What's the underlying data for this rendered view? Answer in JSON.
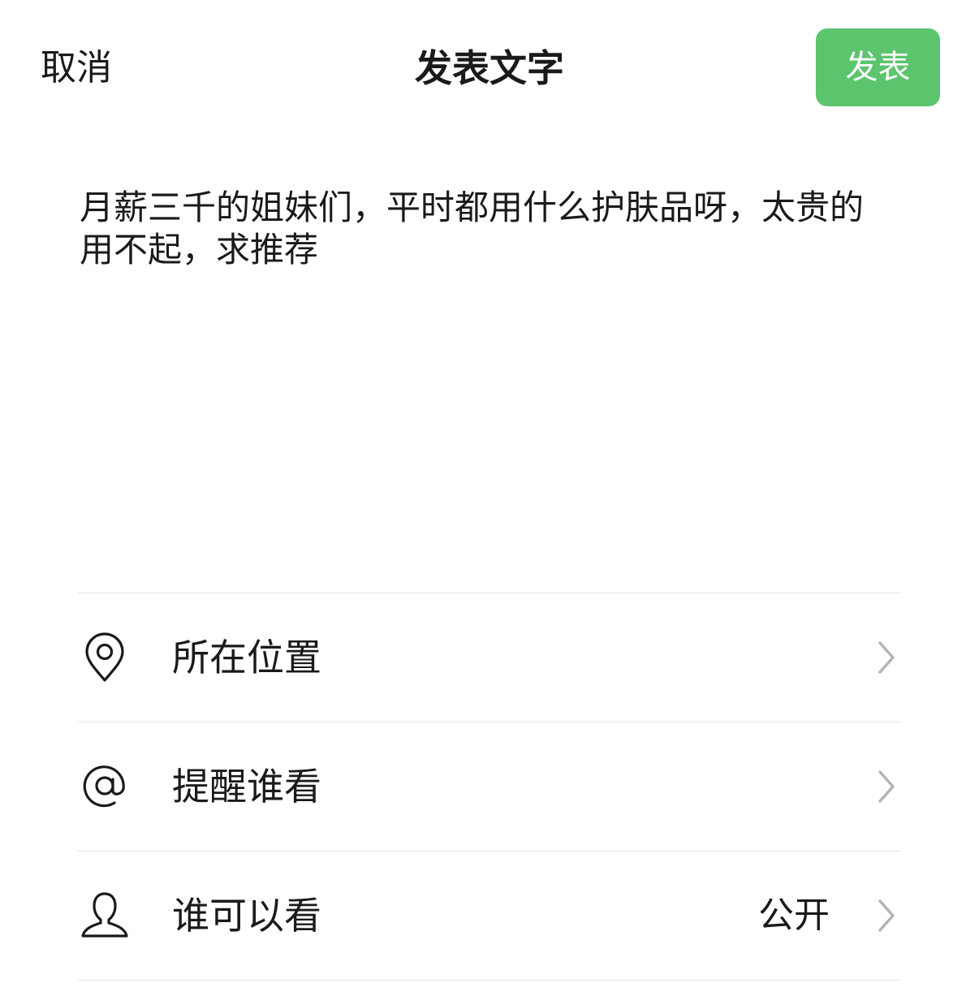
{
  "header": {
    "cancel_label": "取消",
    "title": "发表文字",
    "post_label": "发表"
  },
  "composer": {
    "text": "月薪三千的姐妹们，平时都用什么护肤品呀，太贵的用不起，求推荐"
  },
  "options": [
    {
      "label": "所在位置",
      "icon": "location-pin-icon",
      "value": ""
    },
    {
      "label": "提醒谁看",
      "icon": "at-sign-icon",
      "value": ""
    },
    {
      "label": "谁可以看",
      "icon": "person-icon",
      "value": "公开"
    }
  ],
  "colors": {
    "accent": "#5bc46c",
    "divider": "#e5e5e5",
    "chevron": "#b3b3b3"
  }
}
